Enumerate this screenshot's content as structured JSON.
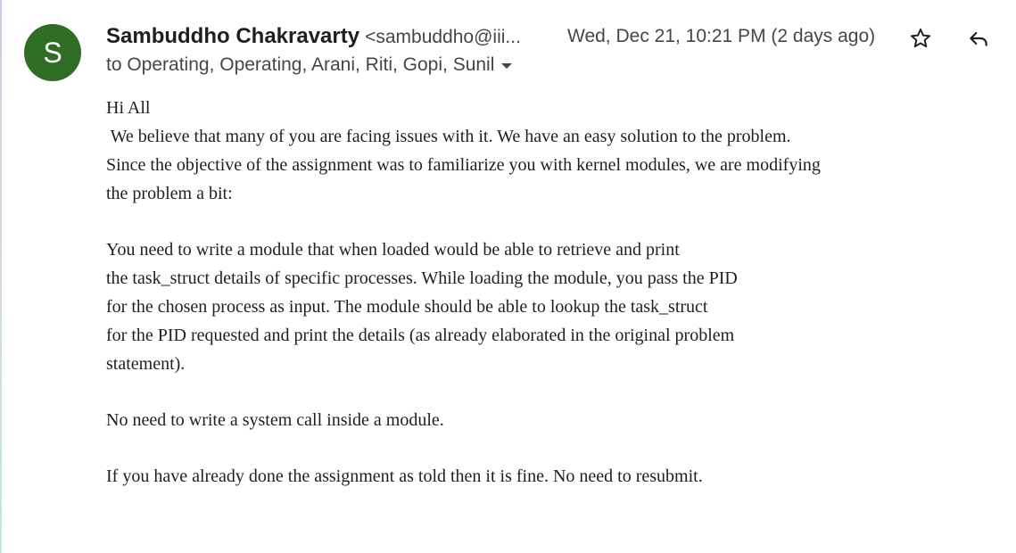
{
  "sender": {
    "avatar_letter": "S",
    "avatar_color": "#2f6d24",
    "name": "Sambuddho Chakravarty",
    "email": "<sambuddho@iii...",
    "timestamp": "Wed, Dec 21, 10:21 PM (2 days ago)"
  },
  "recipients": {
    "text": "to Operating, Operating, Arani, Riti, Gopi, Sunil"
  },
  "actions": {
    "star_icon": "star-outline-icon",
    "reply_icon": "reply-arrow-icon"
  },
  "body": {
    "greeting": "Hi All",
    "para1": [
      " We believe that many of you are facing issues with it. We have an easy solution to the problem.",
      "Since the objective of the assignment was to familiarize you with kernel modules, we are modifying",
      "the problem a bit:"
    ],
    "para2": [
      "You need to write a module that when loaded would be able to retrieve and print",
      "the task_struct details of specific processes. While loading the module, you pass the PID",
      "for the chosen process as input. The module should be able to lookup the task_struct",
      "for the PID requested and print the details (as already elaborated in the original problem",
      "statement)."
    ],
    "para3": "No need to write a system call inside a module.",
    "para4": "If you have already done the assignment as told then it is fine. No need to resubmit.",
    "signature": "--"
  }
}
